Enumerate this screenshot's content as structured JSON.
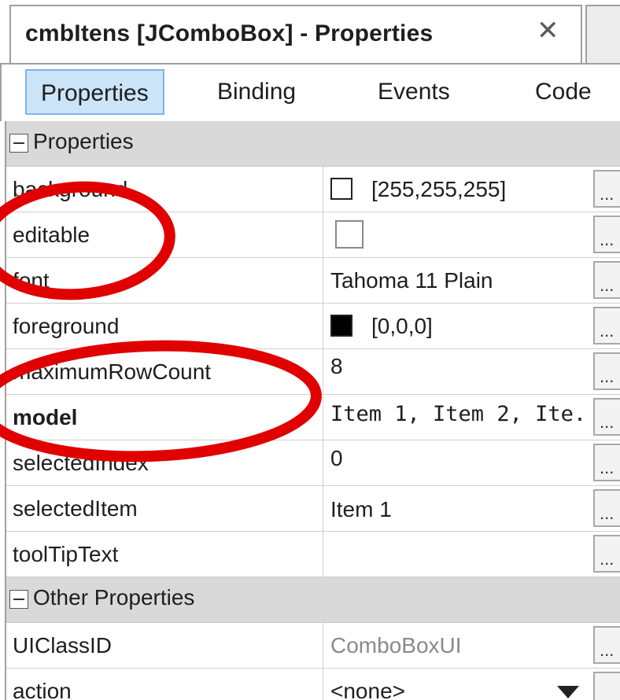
{
  "title_tab": {
    "title": "cmbItens [JComboBox] - Properties",
    "close_icon": "close-icon"
  },
  "toolbar": {
    "properties": "Properties",
    "binding": "Binding",
    "events": "Events",
    "code": "Code"
  },
  "sections": {
    "properties": "Properties",
    "other_properties": "Other Properties"
  },
  "rows": {
    "background": {
      "name": "background",
      "value": "[255,255,255]",
      "ellipsis": "..."
    },
    "editable": {
      "name": "editable",
      "ellipsis": "..."
    },
    "font": {
      "name": "font",
      "value": "Tahoma 11 Plain",
      "ellipsis": "..."
    },
    "foreground": {
      "name": "foreground",
      "value": "[0,0,0]",
      "ellipsis": "..."
    },
    "maximumRowCount": {
      "name": "maximumRowCount",
      "value": "8",
      "ellipsis": "..."
    },
    "model": {
      "name": "model",
      "value": "Item 1, Item 2, Ite...",
      "ellipsis": "..."
    },
    "selectedIndex": {
      "name": "selectedIndex",
      "value": "0",
      "ellipsis": "..."
    },
    "selectedItem": {
      "name": "selectedItem",
      "value": "Item 1",
      "ellipsis": "..."
    },
    "toolTipText": {
      "name": "toolTipText",
      "value": "",
      "ellipsis": "..."
    },
    "UIClassID": {
      "name": "UIClassID",
      "value": "ComboBoxUI",
      "ellipsis": "..."
    },
    "action": {
      "name": "action",
      "value": "<none>"
    }
  },
  "colors": {
    "active_tab_bg": "#cce4f7",
    "active_tab_border": "#7eb4ea",
    "section_bg": "#d9d9d9",
    "annotation_red": "#e00000"
  }
}
